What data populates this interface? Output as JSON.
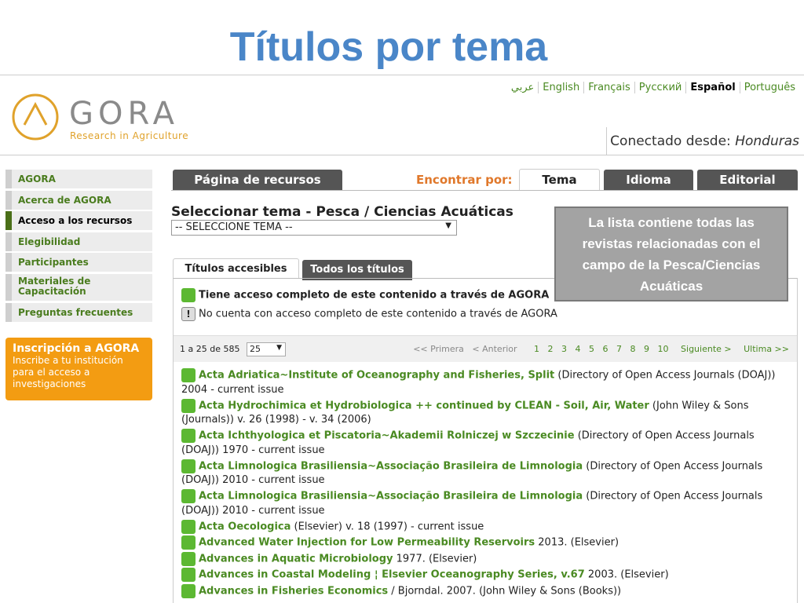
{
  "slide_title": "Títulos por tema",
  "languages": [
    {
      "label": "عربي",
      "active": false
    },
    {
      "label": "English",
      "active": false
    },
    {
      "label": "Français",
      "active": false
    },
    {
      "label": "Русский",
      "active": false
    },
    {
      "label": "Español",
      "active": true
    },
    {
      "label": "Português",
      "active": false
    }
  ],
  "logo": {
    "word": "GORA",
    "tagline": "Research in Agriculture"
  },
  "connected": {
    "label": "Conectado desde:",
    "country": "Honduras"
  },
  "sidebar": [
    {
      "label": "AGORA"
    },
    {
      "label": "Acerca de AGORA"
    },
    {
      "label": "Acceso a los recursos"
    },
    {
      "label": "Elegibilidad"
    },
    {
      "label": "Participantes"
    },
    {
      "label": "Materiales de Capacitación"
    },
    {
      "label": "Preguntas frecuentes"
    }
  ],
  "signup": {
    "heading": "Inscripción a AGORA",
    "text": "Inscribe a tu institución para el acceso a investigaciones"
  },
  "tabs": {
    "resources": "Página de recursos",
    "find_by": "Encontrar por:",
    "topic": "Tema",
    "language": "Idioma",
    "publisher": "Editorial"
  },
  "select_title": "Seleccionar tema - Pesca / Ciencias Acuáticas",
  "select_value": "-- SELECCIONE TEMA --",
  "callout": "La lista contiene todas las revistas relacionadas con el campo de la Pesca/Ciencias Acuáticas",
  "subtabs": {
    "accessible": "Títulos accesibles",
    "all": "Todos los títulos"
  },
  "legend": {
    "full": "Tiene acceso completo de este contenido a través de AGORA",
    "none": "No cuenta con acceso completo de este contenido a través de AGORA",
    "warn_glyph": "!"
  },
  "pager": {
    "count": "1 a 25 de 585",
    "per_page": "25",
    "first": "<< Primera",
    "prev": "< Anterior",
    "pages": [
      "1",
      "2",
      "3",
      "4",
      "5",
      "6",
      "7",
      "8",
      "9",
      "10"
    ],
    "next": "Siguiente >",
    "last": "Ultima >>"
  },
  "results": [
    {
      "title": "Acta Adriatica~Institute of Oceanography and Fisheries, Split",
      "detail": " (Directory of Open Access Journals (DOAJ)) 2004 - current issue"
    },
    {
      "title": "Acta Hydrochimica et Hydrobiologica ++ continued by CLEAN - Soil, Air, Water",
      "detail": " (John Wiley & Sons (Journals)) v. 26 (1998) - v. 34 (2006)"
    },
    {
      "title": "Acta Ichthyologica et Piscatoria~Akademii Rolniczej w Szczecinie",
      "detail": " (Directory of Open Access Journals (DOAJ)) 1970 - current issue"
    },
    {
      "title": "Acta Limnologica Brasiliensia~Associação Brasileira de Limnologia",
      "detail": " (Directory of Open Access Journals (DOAJ)) 2010 - current issue"
    },
    {
      "title": "Acta Limnologica Brasiliensia~Associação Brasileira de Limnologia",
      "detail": " (Directory of Open Access Journals (DOAJ)) 2010 - current issue"
    },
    {
      "title": "Acta Oecologica",
      "detail": " (Elsevier) v. 18 (1997) - current issue"
    },
    {
      "title": "Advanced Water Injection for Low Permeability Reservoirs",
      "detail": " 2013. (Elsevier)"
    },
    {
      "title": "Advances in Aquatic Microbiology",
      "detail": " 1977. (Elsevier)"
    },
    {
      "title": "Advances in Coastal Modeling ¦ Elsevier Oceanography Series, v.67",
      "detail": " 2003. (Elsevier)"
    },
    {
      "title": "Advances in Fisheries Economics",
      "detail": " / Bjorndal. 2007. (John Wiley & Sons (Books))"
    }
  ]
}
